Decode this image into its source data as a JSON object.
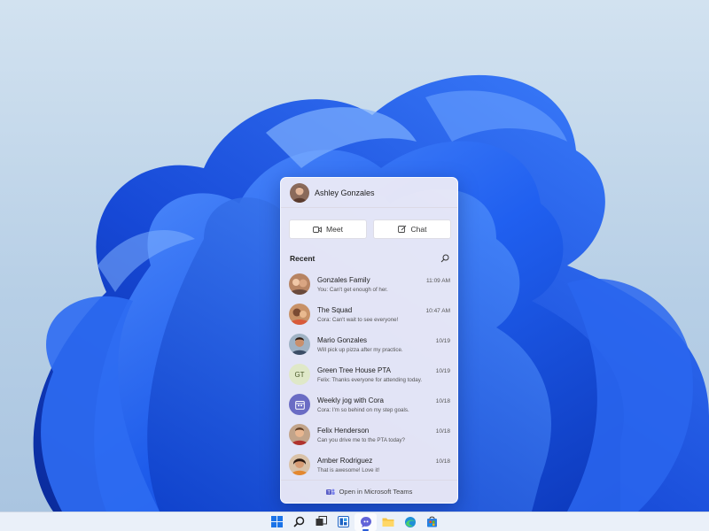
{
  "colors": {
    "accent": "#2a5bd7",
    "wallpaper_blue": "#1d56e6",
    "flyout_bg": "#eeecf6"
  },
  "flyout": {
    "user": {
      "name": "Ashley Gonzales",
      "avatar_icon": "user-avatar"
    },
    "actions": [
      {
        "label": "Meet",
        "icon": "video-camera-icon"
      },
      {
        "label": "Chat",
        "icon": "compose-icon"
      }
    ],
    "recent_label": "Recent",
    "search_icon": "search-icon",
    "conversations": [
      {
        "name": "Gonzales Family",
        "time": "11:09 AM",
        "preview": "You: Can't get enough of her.",
        "avatar": "group-photo"
      },
      {
        "name": "The Squad",
        "time": "10:47 AM",
        "preview": "Cora: Can't wait to see everyone!",
        "avatar": "group-photo"
      },
      {
        "name": "Mario Gonzales",
        "time": "10/19",
        "preview": "Will pick up pizza after my practice.",
        "avatar": "person-photo"
      },
      {
        "name": "Green Tree House PTA",
        "time": "10/19",
        "preview": "Felix: Thanks everyone for attending today.",
        "avatar": "GT"
      },
      {
        "name": "Weekly jog with Cora",
        "time": "10/18",
        "preview": "Cora: I'm so behind on my step goals.",
        "avatar": "calendar-icon"
      },
      {
        "name": "Felix Henderson",
        "time": "10/18",
        "preview": "Can you drive me to the PTA today?",
        "avatar": "person-photo"
      },
      {
        "name": "Amber Rodriguez",
        "time": "10/18",
        "preview": "That is awesome! Love it!",
        "avatar": "person-photo"
      }
    ],
    "footer_label": "Open in Microsoft Teams",
    "footer_icon": "teams-icon"
  },
  "taskbar": {
    "icons": [
      {
        "name": "start-icon",
        "active": false
      },
      {
        "name": "search-icon",
        "active": false
      },
      {
        "name": "task-view-icon",
        "active": false
      },
      {
        "name": "widgets-icon",
        "active": false
      },
      {
        "name": "chat-icon",
        "active": true
      },
      {
        "name": "file-explorer-icon",
        "active": false
      },
      {
        "name": "edge-icon",
        "active": false
      },
      {
        "name": "store-icon",
        "active": false
      }
    ]
  }
}
